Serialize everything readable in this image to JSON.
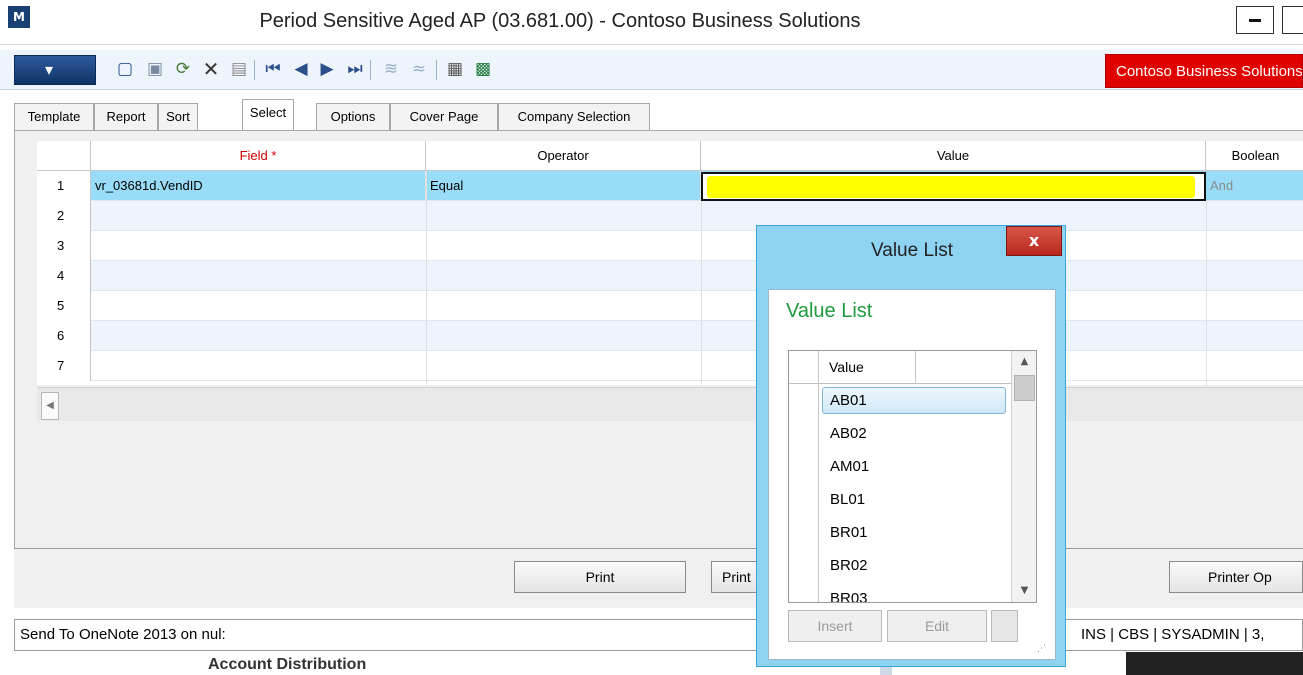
{
  "window": {
    "title": "Period Sensitive Aged AP (03.681.00) - Contoso Business Solutions",
    "logo_glyph": "M",
    "minimize_glyph": "–"
  },
  "toolbar": {
    "brand_badge": "Contoso Business Solutions",
    "icons": [
      "new-doc-icon",
      "save-icon",
      "refresh-icon",
      "delete-icon",
      "copy-icon",
      "first-icon",
      "prev-icon",
      "next-icon",
      "last-icon",
      "attach-icon",
      "note-icon",
      "export-icon",
      "excel-icon"
    ]
  },
  "tabs": [
    "Template",
    "Report",
    "Sort",
    "Select",
    "Options",
    "Cover Page",
    "Company Selection"
  ],
  "grid": {
    "headers": {
      "field": "Field *",
      "operator": "Operator",
      "value": "Value",
      "boolean": "Boolean"
    },
    "rows": [
      {
        "num": "1",
        "field": "vr_03681d.VendID",
        "operator": "Equal",
        "value": "",
        "boolean": "And"
      },
      {
        "num": "2",
        "field": "",
        "operator": "",
        "value": "",
        "boolean": ""
      },
      {
        "num": "3",
        "field": "",
        "operator": "",
        "value": "",
        "boolean": ""
      },
      {
        "num": "4",
        "field": "",
        "operator": "",
        "value": "",
        "boolean": ""
      },
      {
        "num": "5",
        "field": "",
        "operator": "",
        "value": "",
        "boolean": ""
      },
      {
        "num": "6",
        "field": "",
        "operator": "",
        "value": "",
        "boolean": ""
      },
      {
        "num": "7",
        "field": "",
        "operator": "",
        "value": "",
        "boolean": ""
      }
    ]
  },
  "buttons": {
    "print": "Print",
    "print_preview": "Print",
    "printer_options": "Printer Op"
  },
  "statusbar": {
    "left": "Send To OneNote 2013 on nul:",
    "right": "INS | CBS | SYSADMIN | 3,"
  },
  "background": {
    "text": "Account Distribution"
  },
  "value_list_dialog": {
    "title": "Value List",
    "heading": "Value List",
    "column": "Value",
    "items": [
      "AB01",
      "AB02",
      "AM01",
      "BL01",
      "BR01",
      "BR02",
      "BR03"
    ],
    "selected_item": "AB01",
    "insert_label": "Insert",
    "edit_label": "Edit",
    "close_glyph": "x"
  },
  "colors": {
    "brand": "#e00000",
    "selected_row": "#99dcf8",
    "highlight": "#ffff00",
    "heading_green": "#1f9a3e"
  }
}
